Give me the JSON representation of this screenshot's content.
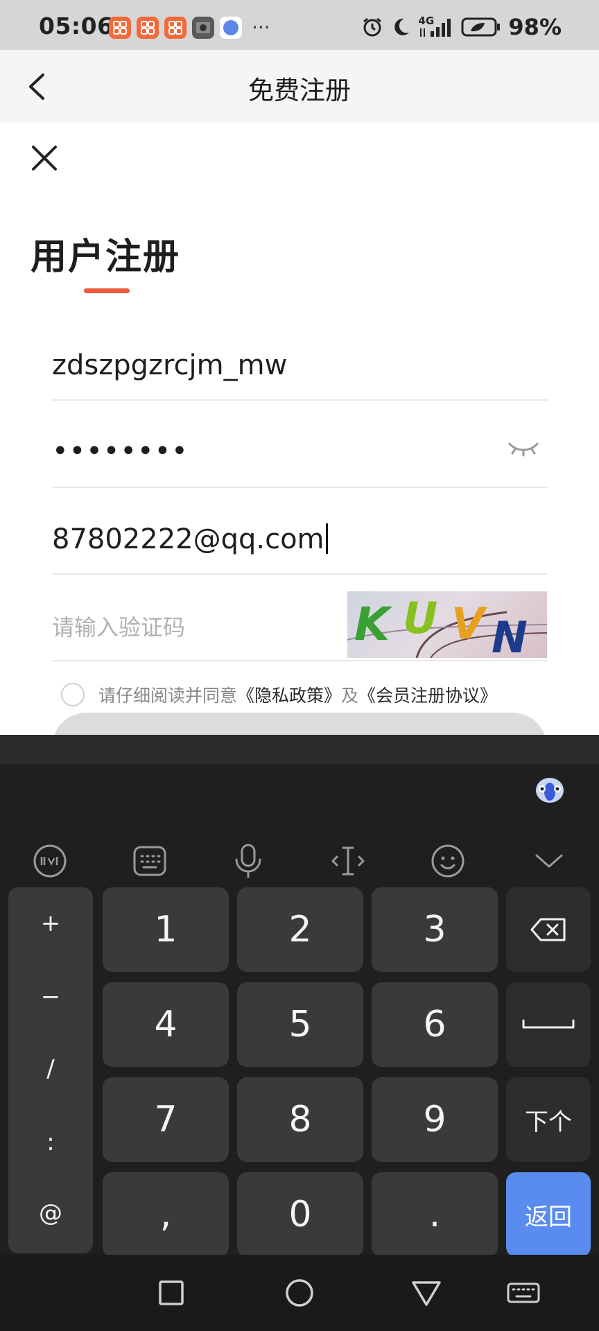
{
  "status_bar": {
    "time": "05:06",
    "network": "4G",
    "battery": "98%",
    "more": "···"
  },
  "nav": {
    "title": "免费注册"
  },
  "form": {
    "title": "用户注册",
    "username_value": "zdszpgzrcjm_mw",
    "password_masked": "••••••••",
    "email_value": "87802222@qq.com",
    "captcha_placeholder": "请输入验证码",
    "captcha_text": "KUVN",
    "agree_prefix": "请仔细阅读并同意",
    "privacy_link": "《隐私政策》",
    "agree_and": "及",
    "terms_link": "《会员注册协议》"
  },
  "keyboard": {
    "symbols": [
      "+",
      "−",
      "/",
      ":",
      "@"
    ],
    "keys": [
      "1",
      "2",
      "3",
      "4",
      "5",
      "6",
      "7",
      "8",
      "9",
      ",",
      "0",
      "."
    ],
    "next_label": "下个",
    "return_label": "返回",
    "accent_color": "#5a8cf0"
  },
  "colors": {
    "brand_accent": "#ea5a3c"
  }
}
